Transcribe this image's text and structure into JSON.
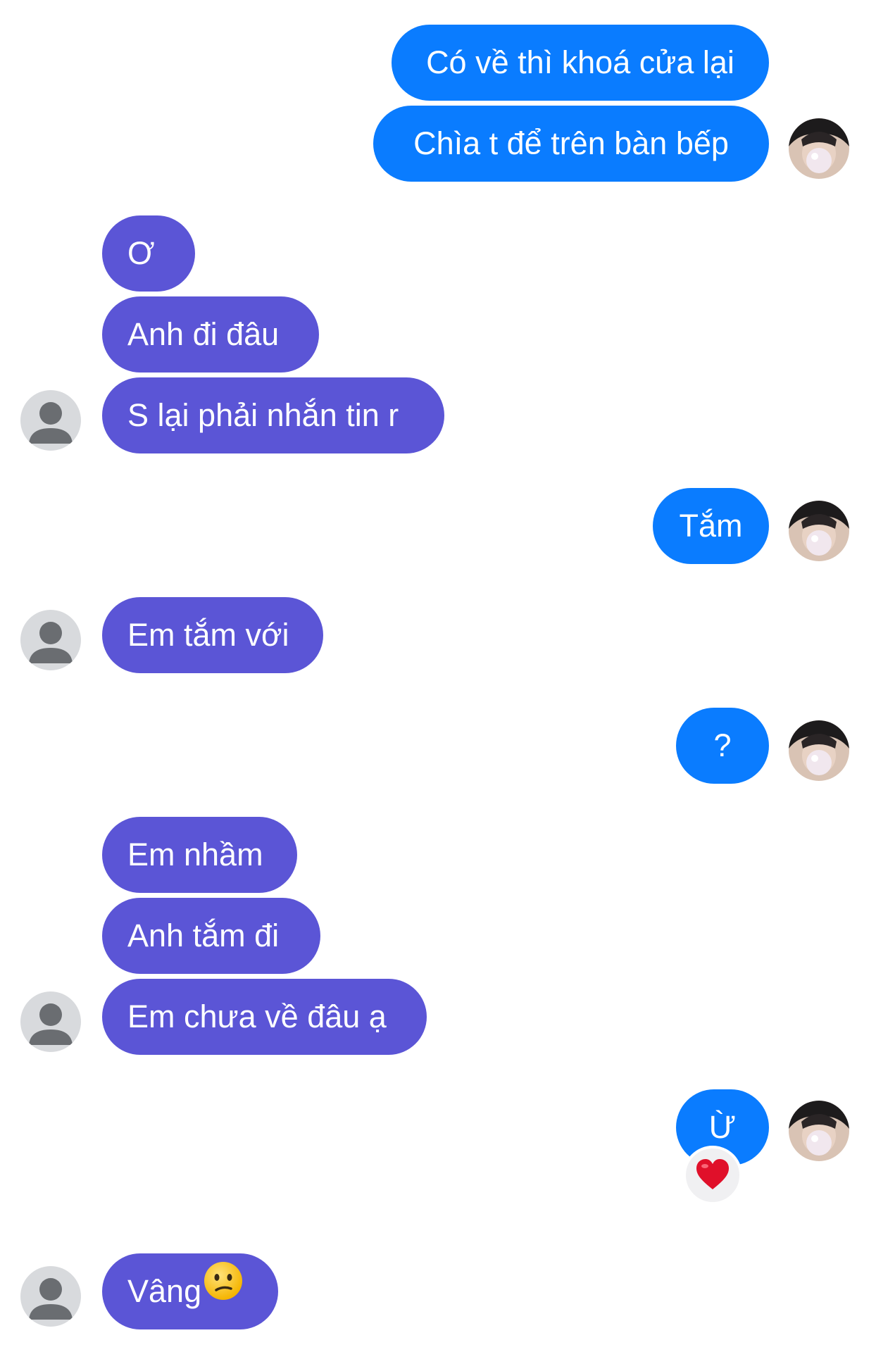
{
  "messages": [
    {
      "text": "Có về thì khoá cửa lại"
    },
    {
      "text": "Chìa t để trên bàn bếp"
    },
    {
      "text": "Ơ"
    },
    {
      "text": "Anh đi đâu"
    },
    {
      "text": "S lại phải nhắn tin r"
    },
    {
      "text": "Tắm"
    },
    {
      "text": "Em tắm với"
    },
    {
      "text": "?"
    },
    {
      "text": "Em nhầm"
    },
    {
      "text": "Anh tắm đi"
    },
    {
      "text": "Em chưa về đâu ạ"
    },
    {
      "text": "Ừ",
      "reaction": "heart-icon"
    },
    {
      "text": "Vâng",
      "emoji": "confused-face-icon"
    }
  ],
  "colors": {
    "outgoing_bubble": "#0a7cff",
    "incoming_bubble": "#5b55d6",
    "background": "#ffffff",
    "reaction_background": "#f0f0f2"
  },
  "icons": {
    "self_avatar": "self-avatar-photo",
    "contact_avatar": "default-person-avatar-icon",
    "reaction": "heart-icon",
    "emoji": "confused-face-icon"
  }
}
